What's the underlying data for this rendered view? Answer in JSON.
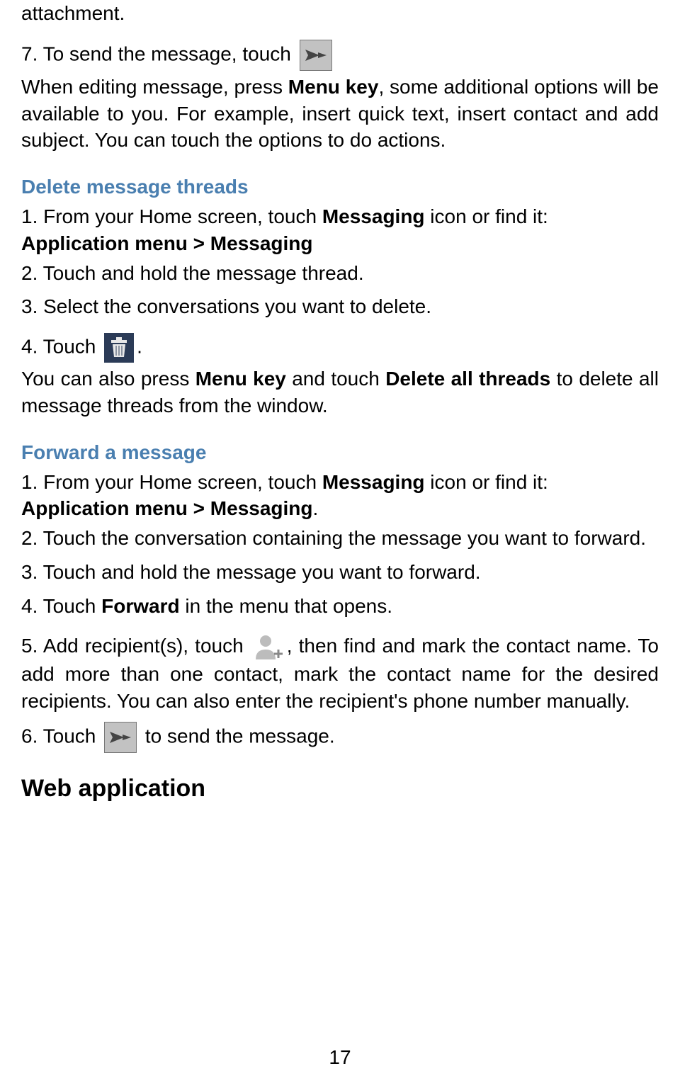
{
  "top_fragment": "attachment.",
  "step7_pre": "7. To send the message, touch",
  "step7_editing_pre": "When editing message, press ",
  "step7_editing_bold": "Menu key",
  "step7_editing_post": ", some additional options will be available to you. For example, insert quick text, insert contact and add subject. You can touch the options to do actions.",
  "delete_heading": "Delete message threads",
  "delete_step1_pre": "1. From your Home screen, touch ",
  "delete_step1_bold1": "Messaging",
  "delete_step1_mid": " icon or find it: ",
  "delete_step1_bold2": "Application menu > Messaging",
  "delete_step2": "2. Touch and hold the message thread.",
  "delete_step3": "3. Select the conversations you want to delete.",
  "delete_step4_pre": "4. Touch ",
  "delete_step4_post": ".",
  "delete_also_pre": "You can also press ",
  "delete_also_bold1": "Menu key",
  "delete_also_mid": " and touch ",
  "delete_also_bold2": "Delete all threads",
  "delete_also_post": " to delete all message threads from the window.",
  "forward_heading": "Forward a message",
  "forward_step1_pre": "1. From your Home screen, touch ",
  "forward_step1_bold1": "Messaging",
  "forward_step1_mid": " icon or find it: ",
  "forward_step1_bold2": "Application menu > Messaging",
  "forward_step1_post": ".",
  "forward_step2": "2. Touch the conversation containing the message you want to forward.",
  "forward_step3": "3. Touch and hold the message you want to forward.",
  "forward_step4_pre": "4. Touch ",
  "forward_step4_bold": "Forward",
  "forward_step4_post": " in the menu that opens.",
  "forward_step5_pre": "5. Add recipient(s), touch ",
  "forward_step5_post": ", then find and mark the contact name. To add more than one contact, mark the contact name for the desired recipients. You can also enter the recipient's phone number manually.",
  "forward_step6_pre": "6. Touch ",
  "forward_step6_post": " to send the message.",
  "web_heading": "Web application",
  "page_number": "17"
}
